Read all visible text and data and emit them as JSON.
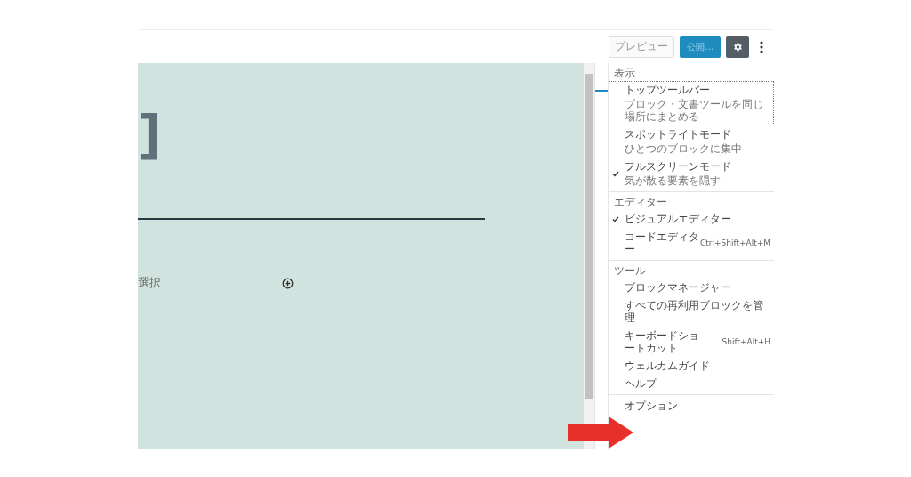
{
  "toolbar": {
    "preview": "プレビュー",
    "publish": "公開...",
    "settings_selected": true
  },
  "canvas": {
    "heading_fragment": "]",
    "paragraph_fragment": "選択"
  },
  "menu": {
    "sections": [
      {
        "label": "表示",
        "items": [
          {
            "label": "トップツールバー",
            "description": "ブロック・文書ツールを同じ場所にまとめる",
            "checked": false,
            "focused": true
          },
          {
            "label": "スポットライトモード",
            "description": "ひとつのブロックに集中",
            "checked": false,
            "focused": false
          },
          {
            "label": "フルスクリーンモード",
            "description": "気が散る要素を隠す",
            "checked": true,
            "focused": false
          }
        ]
      },
      {
        "label": "エディター",
        "items": [
          {
            "label": "ビジュアルエディター",
            "checked": true,
            "focused": false
          },
          {
            "label": "コードエディター",
            "shortcut": "Ctrl+Shift+Alt+M",
            "checked": false,
            "focused": false
          }
        ]
      },
      {
        "label": "ツール",
        "items": [
          {
            "label": "ブロックマネージャー",
            "checked": false,
            "focused": false
          },
          {
            "label": "すべての再利用ブロックを管理",
            "checked": false,
            "focused": false
          },
          {
            "label": "キーボードショートカット",
            "shortcut": "Shift+Alt+H",
            "checked": false,
            "focused": false
          },
          {
            "label": "ウェルカムガイド",
            "checked": false,
            "focused": false
          },
          {
            "label": "ヘルプ",
            "checked": false,
            "focused": false
          }
        ]
      },
      {
        "items": [
          {
            "label": "オプション",
            "checked": false,
            "focused": false
          }
        ]
      }
    ]
  }
}
